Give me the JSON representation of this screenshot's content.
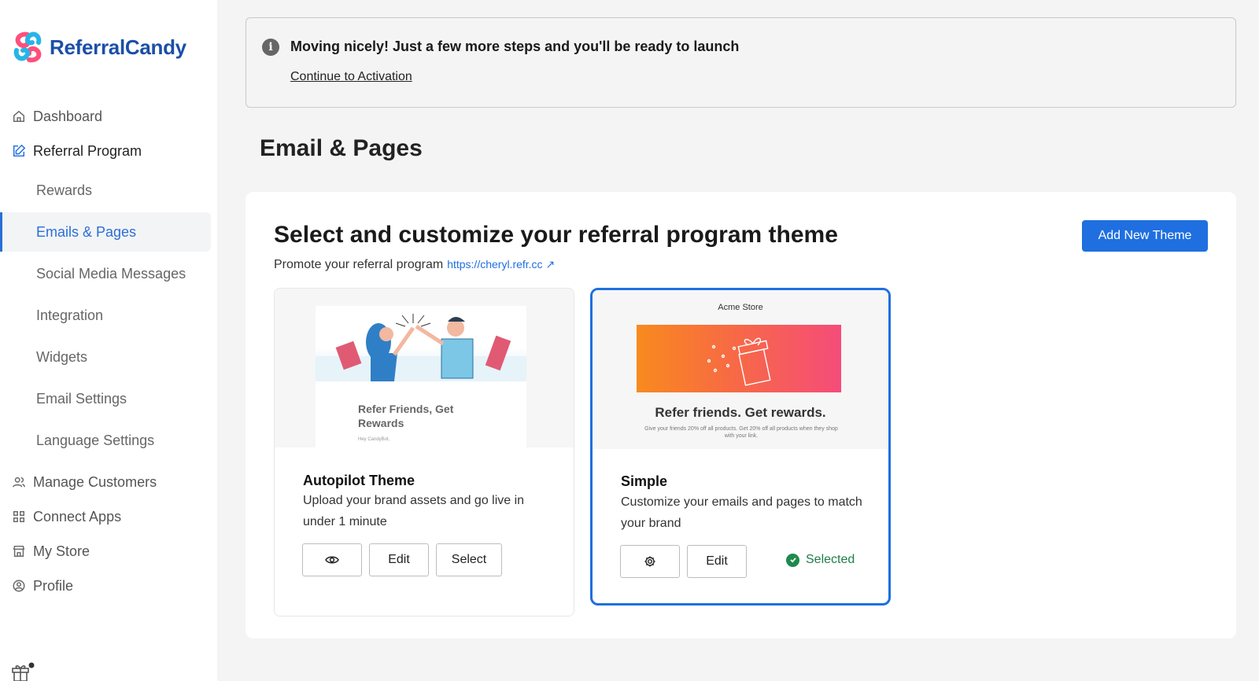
{
  "brand": {
    "name": "ReferralCandy",
    "color": "#1b4fa8"
  },
  "sidebar": {
    "items": [
      {
        "label": "Dashboard",
        "icon": "home-icon"
      },
      {
        "label": "Referral Program",
        "icon": "edit-icon"
      },
      {
        "label": "Manage Customers",
        "icon": "users-icon"
      },
      {
        "label": "Connect Apps",
        "icon": "apps-grid-icon"
      },
      {
        "label": "My Store",
        "icon": "store-icon"
      },
      {
        "label": "Profile",
        "icon": "profile-icon"
      }
    ],
    "subitems": [
      {
        "label": "Rewards"
      },
      {
        "label": "Emails & Pages",
        "active": true
      },
      {
        "label": "Social Media Messages"
      },
      {
        "label": "Integration"
      },
      {
        "label": "Widgets"
      },
      {
        "label": "Email Settings"
      },
      {
        "label": "Language Settings"
      }
    ]
  },
  "banner": {
    "title": "Moving nicely! Just a few more steps and you'll be ready to launch",
    "link": "Continue to Activation",
    "icon": "info-icon"
  },
  "page": {
    "title": "Email & Pages"
  },
  "panel": {
    "title": "Select and customize your referral program theme",
    "subtitle": "Promote your referral program",
    "link": "https://cheryl.refr.cc",
    "add_button": "Add New Theme"
  },
  "themes": [
    {
      "name": "Autopilot Theme",
      "description": "Upload your brand assets and go live in under 1 minute",
      "preview_text": "Refer Friends, Get Rewards",
      "preview_small": "Hey CandyBot,",
      "buttons": {
        "preview_icon": "eye-icon",
        "edit": "Edit",
        "select": "Select"
      }
    },
    {
      "name": "Simple",
      "description": "Customize your emails and pages to match your brand",
      "preview_store": "Acme Store",
      "preview_text": "Refer friends. Get rewards.",
      "preview_small": "Give your friends 20% off all products. Get 20% off all products when they shop with your link.",
      "buttons": {
        "settings_icon": "gear-icon",
        "edit": "Edit"
      },
      "selected_label": "Selected"
    }
  ],
  "colors": {
    "accent": "#1f6fe0",
    "selected_green": "#1e8a4c"
  }
}
